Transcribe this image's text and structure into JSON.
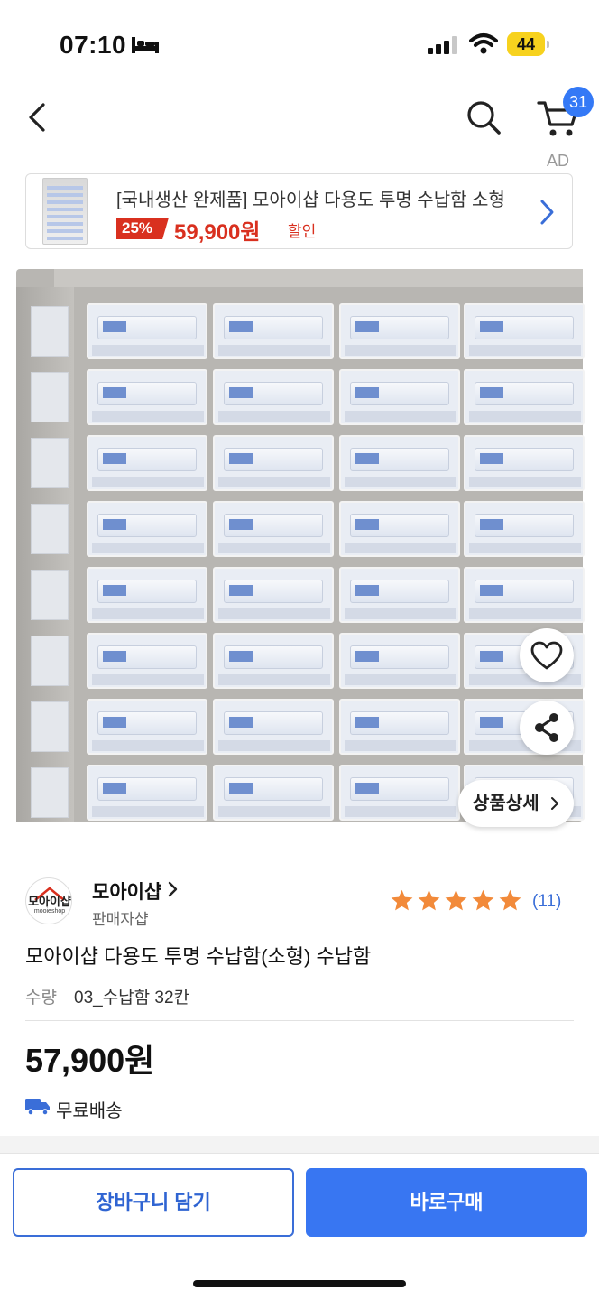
{
  "status_bar": {
    "time": "07:10",
    "battery": "44"
  },
  "nav": {
    "cart_count": "31"
  },
  "ad": {
    "label": "AD",
    "title": "[국내생산 완제품] 모아이샵 다용도 투명 수납함 소형",
    "discount": "25%",
    "price": "59,900원",
    "sale_text": "할인"
  },
  "image_overlay": {
    "detail_label": "상품상세"
  },
  "seller": {
    "logo_text": "모아이샵",
    "logo_sub": "mooieshop",
    "name": "모아이샵",
    "type": "판매자샵",
    "rating_stars": 5,
    "review_count": "(11)"
  },
  "product": {
    "title": "모아이샵 다용도 투명 수납함(소형) 수납함",
    "option_label": "수량",
    "option_value": "03_수납함 32칸",
    "price": "57,900원",
    "shipping": "무료배송"
  },
  "actions": {
    "add_to_cart": "장바구니 담기",
    "buy_now": "바로구매"
  },
  "colors": {
    "accent": "#3876f2",
    "sale": "#d9301f",
    "star": "#f28a3a"
  }
}
